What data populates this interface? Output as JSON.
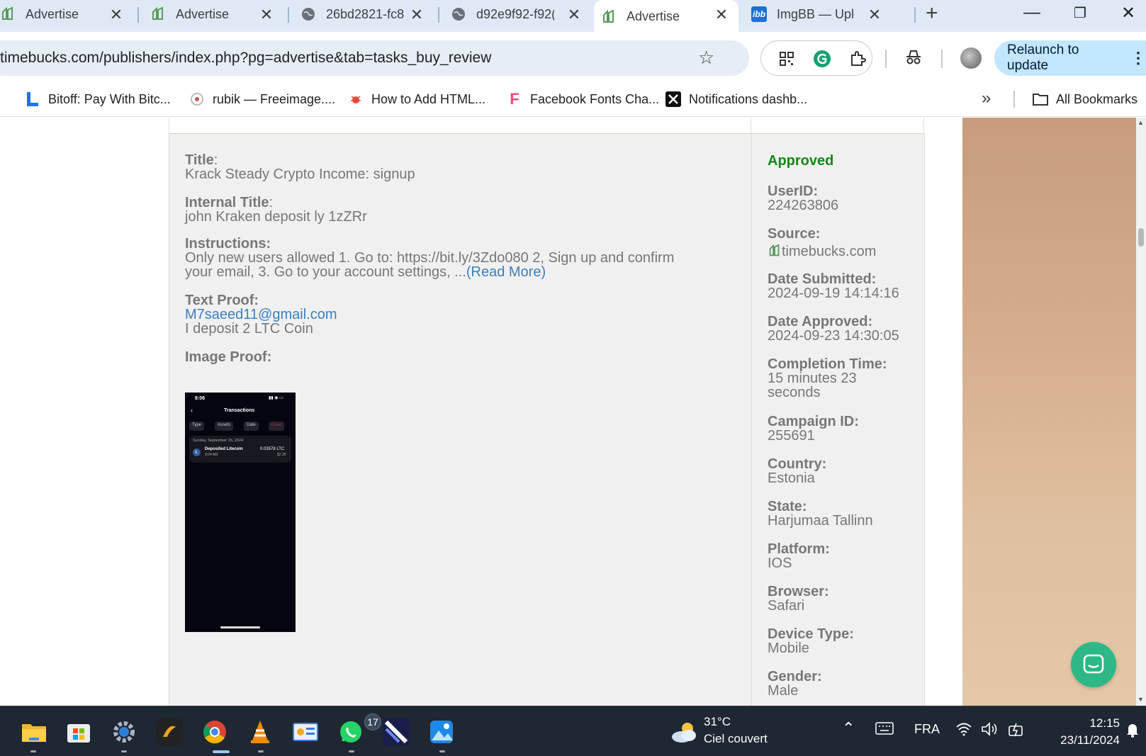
{
  "tabs": [
    {
      "title": "Advertise",
      "favicon": "timebucks-icon"
    },
    {
      "title": "Advertise",
      "favicon": "timebucks-icon"
    },
    {
      "title": "26bd2821-fc8",
      "favicon": "globe-icon"
    },
    {
      "title": "d92e9f92-f92(",
      "favicon": "globe-icon"
    },
    {
      "title": "Advertise",
      "favicon": "timebucks-icon",
      "active": true
    },
    {
      "title": "ImgBB — Uplo",
      "favicon": "imgbb-icon",
      "favicon_text": "ibb"
    }
  ],
  "address_bar": {
    "url": "timebucks.com/publishers/index.php?pg=advertise&tab=tasks_buy_review"
  },
  "relaunch_label": "Relaunch to update",
  "bookmarks": [
    {
      "label": "Bitoff: Pay With Bitc...",
      "icon": "bitoff-icon"
    },
    {
      "label": "rubik — Freeimage....",
      "icon": "freeimage-icon"
    },
    {
      "label": "How to Add HTML...",
      "icon": "bug-icon"
    },
    {
      "label": "Facebook Fonts Cha...",
      "icon": "f-icon",
      "icon_text": "F"
    },
    {
      "label": "Notifications dashb...",
      "icon": "x-logo-icon"
    }
  ],
  "all_bookmarks_label": "All Bookmarks",
  "task": {
    "title_label": "Title",
    "title": "Krack Steady Crypto Income: signup",
    "internal_title_label": "Internal Title",
    "internal_title": "john Kraken deposit ly 1zZRr",
    "instructions_label": "Instructions:",
    "instructions_line1": "Only new users allowed 1. Go to: https://bit.ly/3Zdo080 2, Sign up and confirm",
    "instructions_line2": "your email, 3. Go to your account settings, ...",
    "read_more": "(Read More)",
    "text_proof_label": "Text Proof:",
    "text_proof_email": "M7saeed11@gmail.com",
    "text_proof_text": "I deposit 2 LTC Coin",
    "image_proof_label": "Image Proof:",
    "image_proof": {
      "time": "8:06",
      "header": "Transactions",
      "filters": [
        "Type",
        "Assets",
        "Date",
        "Clear"
      ],
      "date": "Sunday, September 15, 2024",
      "tx_name": "Deposited Litecoin",
      "tx_time": "9:04 AM",
      "tx_amount": "0.03578 LTC",
      "tx_usd": "$2.35"
    }
  },
  "details": {
    "status": "Approved",
    "status_color": "#118a11",
    "fields": [
      {
        "label": "UserID:",
        "value": "224263806"
      },
      {
        "label": "Source:",
        "value": "timebucks.com"
      },
      {
        "label": "Date Submitted:",
        "value": "2024-09-19 14:14:16"
      },
      {
        "label": "Date Approved:",
        "value": "2024-09-23 14:30:05"
      },
      {
        "label": "Completion Time:",
        "value": "15 minutes 23 seconds"
      },
      {
        "label": "Campaign ID:",
        "value": "255691"
      },
      {
        "label": "Country:",
        "value": "Estonia"
      },
      {
        "label": "State:",
        "value": "Harjumaa Tallinn"
      },
      {
        "label": "Platform:",
        "value": "IOS"
      },
      {
        "label": "Browser:",
        "value": "Safari"
      },
      {
        "label": "Device Type:",
        "value": "Mobile"
      },
      {
        "label": "Gender:",
        "value": "Male"
      }
    ]
  },
  "taskbar": {
    "whatsapp_badge": "17",
    "weather_temp": "31°C",
    "weather_desc": "Ciel couvert",
    "language": "FRA",
    "time": "12:15",
    "date": "23/11/2024"
  }
}
